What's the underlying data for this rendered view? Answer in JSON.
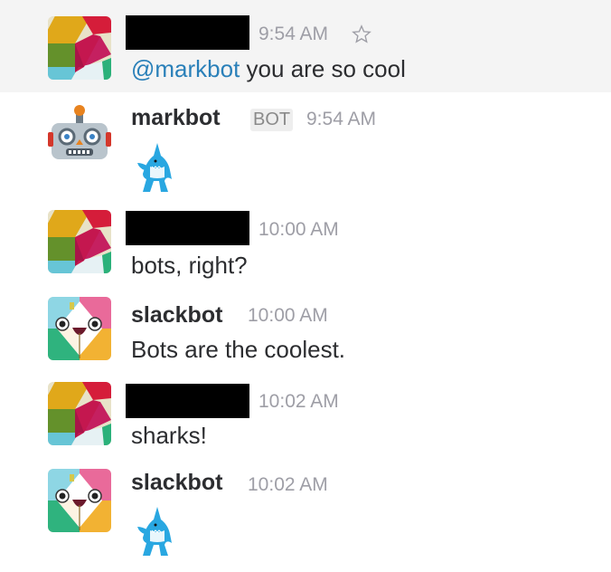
{
  "messages": [
    {
      "time": "9:54 AM",
      "mention": "@markbot",
      "text": " you are so cool",
      "avatar": "slack-logo-avatar",
      "highlighted": true,
      "redacted_name": true
    },
    {
      "name": "markbot",
      "badge": "BOT",
      "time": "9:54 AM",
      "content": "shark-emoji",
      "avatar": "robot-face-avatar"
    },
    {
      "time": "10:00 AM",
      "text": "bots, right?",
      "avatar": "slack-logo-avatar",
      "redacted_name": true
    },
    {
      "name": "slackbot",
      "time": "10:00 AM",
      "text": "Bots are the coolest.",
      "avatar": "slackbot-avatar"
    },
    {
      "time": "10:02 AM",
      "text": "sharks!",
      "avatar": "slack-logo-avatar",
      "redacted_name": true
    },
    {
      "name": "slackbot",
      "time": "10:02 AM",
      "content": "shark-emoji",
      "avatar": "slackbot-avatar"
    }
  ],
  "colors": {
    "mention": "#2a80b9",
    "timestamp": "#9e9ea6",
    "hover_row": "#f4f4f4",
    "text": "#2c2d30"
  },
  "icons": [
    "star-icon",
    "shark-emoji",
    "slack-logo-avatar",
    "robot-face-avatar",
    "slackbot-avatar"
  ]
}
